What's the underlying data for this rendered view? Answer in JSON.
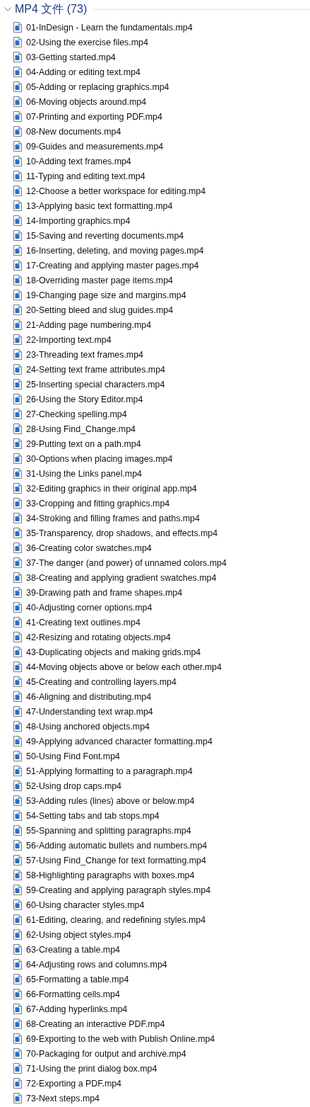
{
  "group": {
    "title": "MP4 文件 (73)",
    "expanded": true
  },
  "files": [
    "01-InDesign - Learn the fundamentals.mp4",
    "02-Using the exercise files.mp4",
    "03-Getting started.mp4",
    "04-Adding or editing text.mp4",
    "05-Adding or replacing graphics.mp4",
    "06-Moving objects around.mp4",
    "07-Printing and exporting PDF.mp4",
    "08-New documents.mp4",
    "09-Guides and measurements.mp4",
    "10-Adding text frames.mp4",
    "11-Typing and editing text.mp4",
    "12-Choose a better workspace for editing.mp4",
    "13-Applying basic text formatting.mp4",
    "14-Importing graphics.mp4",
    "15-Saving and reverting documents.mp4",
    "16-Inserting, deleting, and moving pages.mp4",
    "17-Creating and applying master pages.mp4",
    "18-Overriding master page items.mp4",
    "19-Changing page size and margins.mp4",
    "20-Setting bleed and slug guides.mp4",
    "21-Adding page numbering.mp4",
    "22-Importing text.mp4",
    "23-Threading text frames.mp4",
    "24-Setting text frame attributes.mp4",
    "25-Inserting special characters.mp4",
    "26-Using the Story Editor.mp4",
    "27-Checking spelling.mp4",
    "28-Using Find_Change.mp4",
    "29-Putting text on a path.mp4",
    "30-Options when placing images.mp4",
    "31-Using the Links panel.mp4",
    "32-Editing graphics in their original app.mp4",
    "33-Cropping and fitting graphics.mp4",
    "34-Stroking and filling frames and paths.mp4",
    "35-Transparency, drop shadows, and effects.mp4",
    "36-Creating color swatches.mp4",
    "37-The danger (and power) of unnamed colors.mp4",
    "38-Creating and applying gradient swatches.mp4",
    "39-Drawing path and frame shapes.mp4",
    "40-Adjusting corner options.mp4",
    "41-Creating text outlines.mp4",
    "42-Resizing and rotating objects.mp4",
    "43-Duplicating objects and making grids.mp4",
    "44-Moving objects above or below each other.mp4",
    "45-Creating and controlling layers.mp4",
    "46-Aligning and distributing.mp4",
    "47-Understanding text wrap.mp4",
    "48-Using anchored objects.mp4",
    "49-Applying advanced character formatting.mp4",
    "50-Using Find Font.mp4",
    "51-Applying formatting to a paragraph.mp4",
    "52-Using drop caps.mp4",
    "53-Adding rules (lines) above or below.mp4",
    "54-Setting tabs and tab stops.mp4",
    "55-Spanning and splitting paragraphs.mp4",
    "56-Adding automatic bullets and numbers.mp4",
    "57-Using Find_Change for text formatting.mp4",
    "58-Highlighting paragraphs with boxes.mp4",
    "59-Creating and applying paragraph styles.mp4",
    "60-Using character styles.mp4",
    "61-Editing, clearing, and redefining styles.mp4",
    "62-Using object styles.mp4",
    "63-Creating a table.mp4",
    "64-Adjusting rows and columns.mp4",
    "65-Formatting a table.mp4",
    "66-Formatting cells.mp4",
    "67-Adding hyperlinks.mp4",
    "68-Creating an interactive PDF.mp4",
    "69-Exporting to the web with Publish Online.mp4",
    "70-Packaging for output and archive.mp4",
    "71-Using the print dialog box.mp4",
    "72-Exporting a PDF.mp4",
    "73-Next steps.mp4"
  ]
}
